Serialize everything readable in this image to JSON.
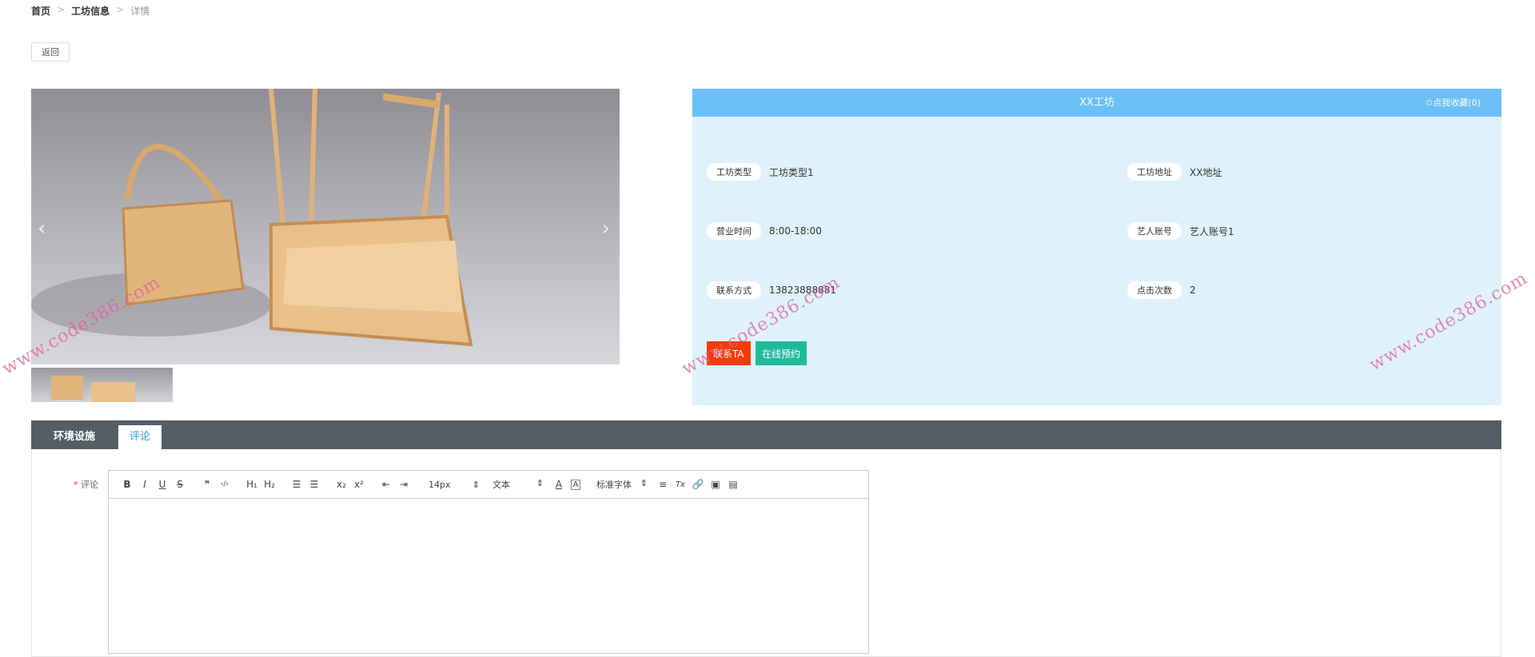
{
  "breadcrumb": {
    "home": "首页",
    "section": "工坊信息",
    "current": "详情",
    "separator": ">"
  },
  "back_label": "返回",
  "carousel": {
    "prev": "‹",
    "next": "›"
  },
  "panel": {
    "title": "XX工坊",
    "favorite": "✩点我收藏(0)",
    "fields": [
      {
        "label": "工坊类型",
        "value": "工坊类型1"
      },
      {
        "label": "工坊地址",
        "value": "XX地址"
      },
      {
        "label": "营业时间",
        "value": "8:00-18:00"
      },
      {
        "label": "艺人账号",
        "value": "艺人账号1"
      },
      {
        "label": "联系方式",
        "value": "13823888881"
      },
      {
        "label": "点击次数",
        "value": "2"
      }
    ],
    "contact_label": "联系TA",
    "book_label": "在线预约"
  },
  "tabs": [
    {
      "label": "环境设施"
    },
    {
      "label": "评论"
    }
  ],
  "comment": {
    "required": "*",
    "label": "评论",
    "toolbar": {
      "bold": "B",
      "italic": "I",
      "underline": "U",
      "strike": "S",
      "quote": "❞",
      "code": "‹/›",
      "h1": "H₁",
      "h2": "H₂",
      "ol": "☰",
      "ul": "☰",
      "sub": "x₂",
      "sup": "x²",
      "outdent": "⇤",
      "indent": "⇥",
      "size": "14px",
      "header": "文本",
      "color": "A",
      "bg": "A",
      "font": "标准字体",
      "align": "≡",
      "clean": "Tx"
    }
  },
  "watermark": "www.code386.com",
  "colors": {
    "header": "#6bc0f7",
    "panel": "#dff2fd",
    "contact": "#f23c0b",
    "book": "#1fbb9c",
    "tabbar": "#555d65",
    "active_tab": "#2f9bd6"
  }
}
